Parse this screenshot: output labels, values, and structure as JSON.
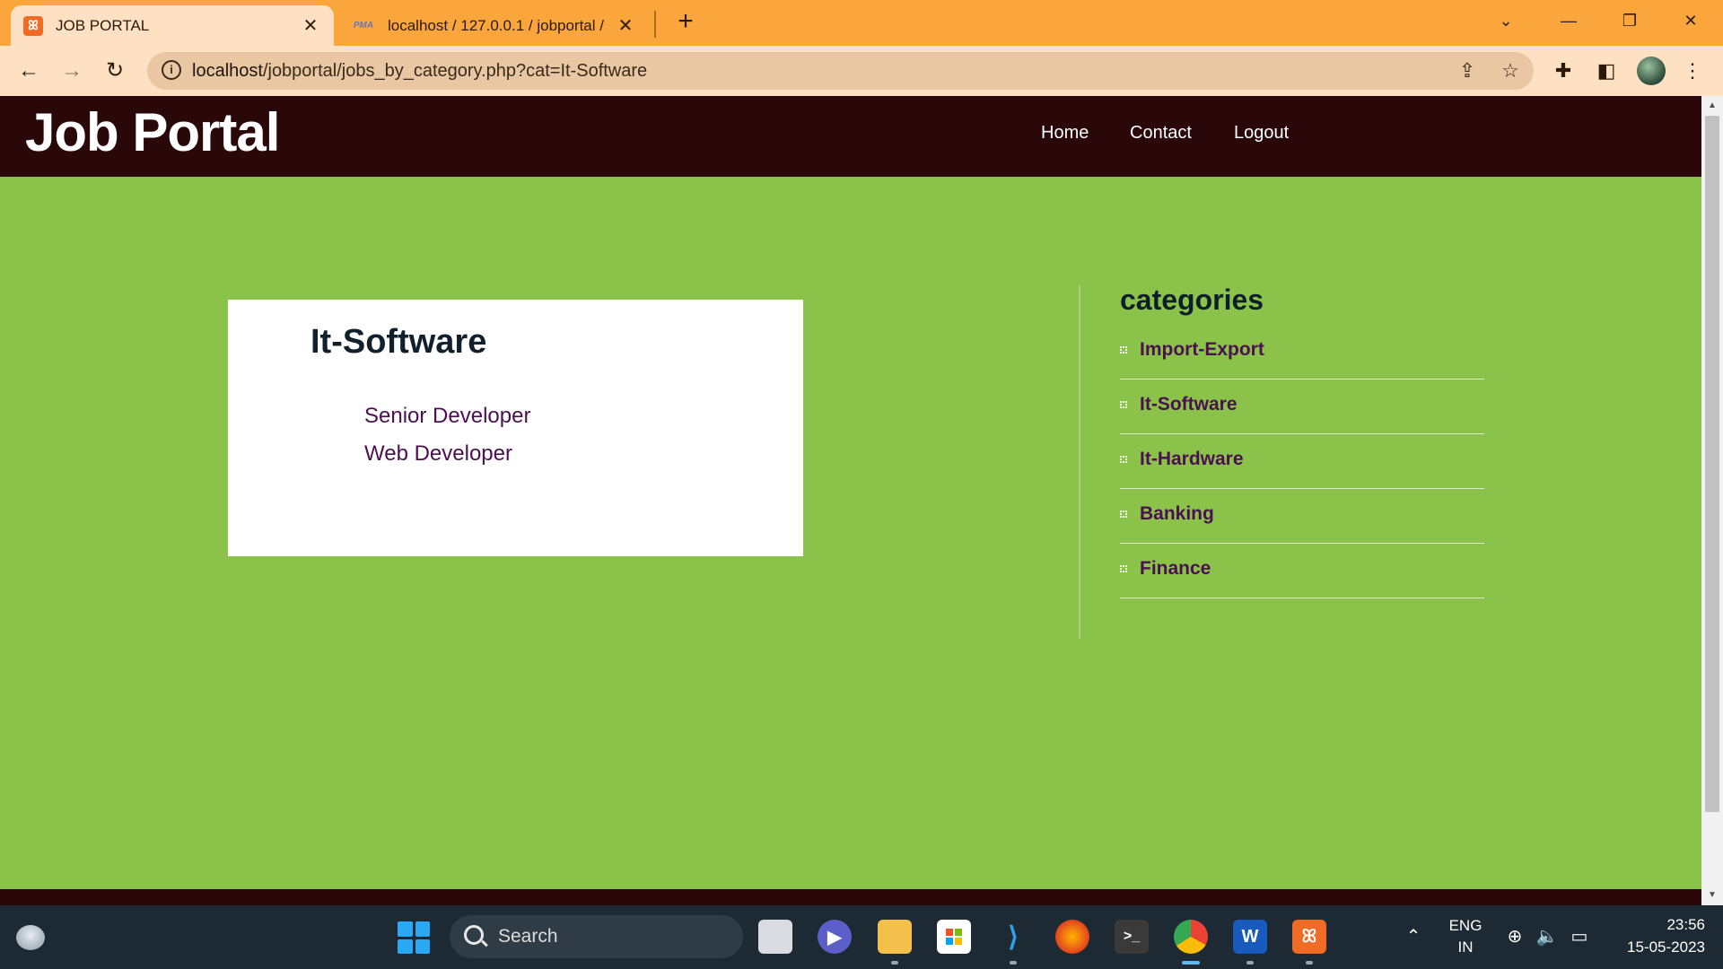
{
  "browser": {
    "tabs": [
      {
        "title": "JOB PORTAL",
        "favicon": "xampp-icon",
        "active": true
      },
      {
        "title": "localhost / 127.0.0.1 / jobportal /",
        "favicon": "phpmyadmin-icon",
        "favicon_text": "PMA",
        "active": false
      }
    ],
    "url_host": "localhost",
    "url_path": "/jobportal/jobs_by_category.php?cat=It-Software"
  },
  "site": {
    "logo": "Job Portal",
    "nav": [
      "Home",
      "Contact",
      "Logout"
    ]
  },
  "jobs": {
    "category_title": "It-Software",
    "items": [
      "Senior Developer",
      "Web Developer"
    ]
  },
  "sidebar": {
    "heading": "categories",
    "items": [
      "Import-Export",
      "It-Software",
      "It-Hardware",
      "Banking",
      "Finance"
    ]
  },
  "taskbar": {
    "search_label": "Search",
    "language": "ENG",
    "region": "IN",
    "time": "23:56",
    "date": "15-05-2023"
  },
  "colors": {
    "page_background": "#8bc34a",
    "header_background": "#2a0709",
    "link_color": "#4a1050",
    "tabbar_background": "#fba63c"
  }
}
